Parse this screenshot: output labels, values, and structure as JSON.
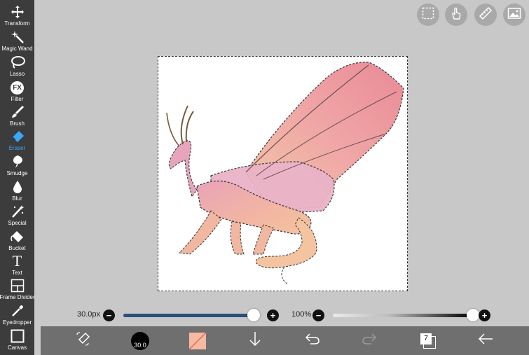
{
  "tools": [
    {
      "label": "Transform",
      "icon": "move-arrows-icon"
    },
    {
      "label": "Magic Wand",
      "icon": "magic-wand-icon"
    },
    {
      "label": "Lasso",
      "icon": "lasso-icon"
    },
    {
      "label": "Filter",
      "icon": "fx-icon",
      "icon_text": "FX"
    },
    {
      "label": "Brush",
      "icon": "brush-icon"
    },
    {
      "label": "Eraser",
      "icon": "eraser-icon",
      "active": true
    },
    {
      "label": "Smudge",
      "icon": "smudge-icon"
    },
    {
      "label": "Blur",
      "icon": "blur-drop-icon"
    },
    {
      "label": "Special",
      "icon": "special-wand-icon"
    },
    {
      "label": "Bucket",
      "icon": "bucket-icon"
    },
    {
      "label": "Text",
      "icon": "text-icon",
      "icon_text": "T"
    },
    {
      "label": "Frame Divider",
      "icon": "frame-divider-icon"
    },
    {
      "label": "Eyedropper",
      "icon": "eyedropper-icon"
    },
    {
      "label": "Canvas",
      "icon": "canvas-icon"
    }
  ],
  "top_buttons": [
    "selection-icon",
    "hand-gesture-icon",
    "ruler-icon",
    "image-icon"
  ],
  "brush_size": {
    "value_text": "30.0px",
    "level": 0.98
  },
  "opacity": {
    "value_text": "100%",
    "level": 1.0
  },
  "bottom_bar": {
    "brush_size_badge": "30.0",
    "layer_count": "7"
  },
  "colors": {
    "toolbar_bg": "#3c3c3c",
    "active_accent": "#38a8ff",
    "size_track": "#2a4f7c",
    "workspace_bg": "#c8c8c8",
    "bottom_bar_bg": "#6f6f6f",
    "swatch_color": "#f7b9a0"
  }
}
